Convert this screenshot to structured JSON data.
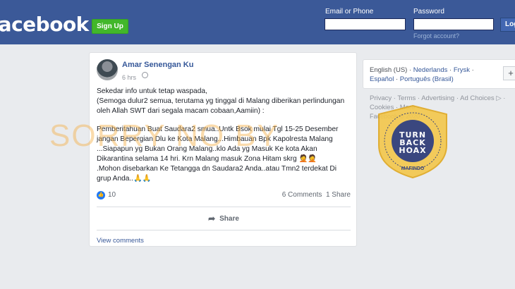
{
  "header": {
    "logo": "facebook",
    "signup_label": "Sign Up",
    "email_label": "Email or Phone",
    "password_label": "Password",
    "forgot_label": "Forgot account?",
    "login_label": "Log In",
    "email_value": "",
    "password_value": ""
  },
  "post": {
    "author": "Amar Senengan Ku",
    "time": "6 hrs",
    "paragraph1": "Sekedar info untuk tetap waspada,\n(Semoga dulur2 semua, terutama yg tinggal di Malang diberikan perlindungan oleh Allah SWT dari segala macam cobaan,Aamiin) :",
    "paragraph2": "Pemberitahuan Buat Saudara2 smua..Untk Bsok mulai Tgl 15-25 Desember jangan Bepergian Dlu ke Kota Malang...Himbauan Bpk Kapolresta Malang ...Siapapun yg Bukan Orang Malang..klo Ada yg Masuk Ke kota Akan Dikarantina selama 14 hri. Krn Malang masuk Zona Hitam skrg 🤦🤦\n.Mohon disebarkan Ke Tetangga dn Saudara2 Anda..atau Tmn2 terdekat Di grup Anda..🙏🙏",
    "like_count": "10",
    "comments": "6 Comments",
    "shares": "1 Share",
    "share_label": "Share",
    "view_comments": "View comments"
  },
  "sidebar": {
    "lang_current": "English (US)",
    "lang_links": [
      "Nederlands",
      "Frysk",
      "Español",
      "Português (Brasil)"
    ],
    "plus": "+",
    "footer_links": "Privacy · Terms · Advertising · Ad Choices ▷ · Cookies · More ·",
    "copyright": "Facebook © 2020"
  },
  "watermark": {
    "text": "SORRY NO BY",
    "badge_line1": "TURN",
    "badge_line2": "BACK",
    "badge_line3": "HOAX",
    "badge_sub": "MAFINDO",
    "badge_color": "#f3c74a"
  }
}
